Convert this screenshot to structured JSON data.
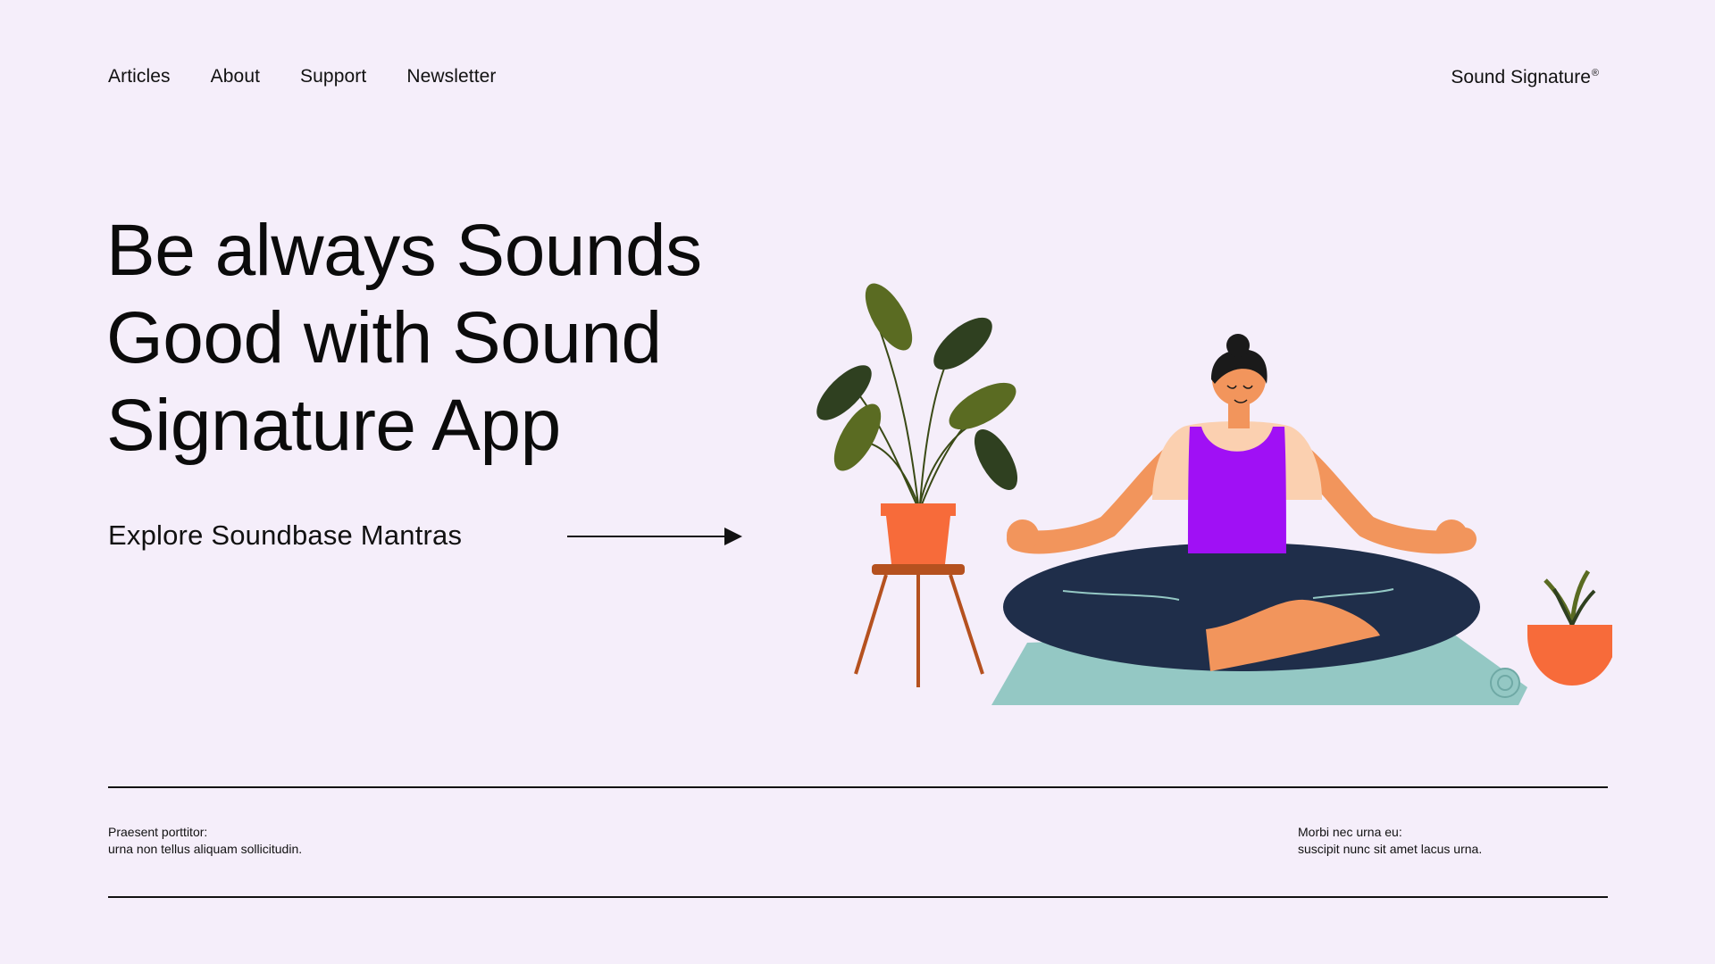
{
  "nav": {
    "items": [
      {
        "label": "Articles"
      },
      {
        "label": "About"
      },
      {
        "label": "Support"
      },
      {
        "label": "Newsletter"
      }
    ]
  },
  "brand": {
    "name": "Sound Signature",
    "mark": "®"
  },
  "hero": {
    "title_lines": [
      "Be always Sounds",
      "Good with Sound",
      "Signature App"
    ],
    "cta_label": "Explore Soundbase Mantras",
    "cta_icon": "arrow-right-icon"
  },
  "illustration": {
    "subject": "meditating-woman-icon",
    "colors": {
      "skin": "#f2955c",
      "top": "#a010f5",
      "pants": "#1f2e4a",
      "mat": "#94c8c4",
      "pot": "#f76b3a",
      "stool": "#b5511f",
      "leaf": "#5a6b22",
      "hair": "#1a1a1a"
    }
  },
  "footer": {
    "left": {
      "line1": "Praesent porttitor:",
      "line2": "urna non tellus aliquam sollicitudin."
    },
    "right": {
      "line1": "Morbi nec urna eu:",
      "line2": "suscipit nunc sit amet lacus urna."
    }
  },
  "colors": {
    "background": "#f5eefa",
    "text": "#111111"
  }
}
